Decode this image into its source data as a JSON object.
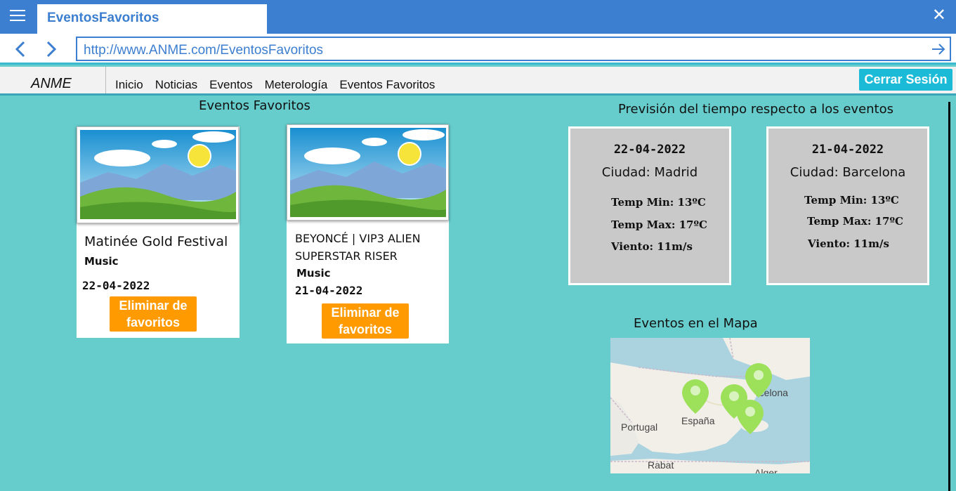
{
  "browser": {
    "tab_title": "EventosFavoritos",
    "url": "http://www.ANME.com/EventosFavoritos"
  },
  "site": {
    "brand": "ANME",
    "menu": [
      "Inicio",
      "Noticias",
      "Eventos",
      "Meterología",
      "Eventos Favoritos"
    ],
    "logout_label": "Cerrar Sesión"
  },
  "favorites": {
    "heading": "Eventos Favoritos",
    "events": [
      {
        "title": "Matinée Gold Festival",
        "tag": "Music",
        "date": "22-04-2022",
        "remove_label": "Eliminar de favoritos"
      },
      {
        "title": "BEYONCÉ | VIP3 ALIEN SUPERSTAR RISER",
        "tag": "Music",
        "date": "21-04-2022",
        "remove_label": "Eliminar de favoritos"
      }
    ]
  },
  "weather": {
    "heading": "Previsión del tiempo respecto a los eventos",
    "forecasts": [
      {
        "date": "22-04-2022",
        "city": "Ciudad: Madrid",
        "temp_min": "Temp Min: 13ºC",
        "temp_max": "Temp Max: 17ºC",
        "wind": "Viento: 11m/s"
      },
      {
        "date": "21-04-2022",
        "city": "Ciudad: Barcelona",
        "temp_min": "Temp Min: 13ºC",
        "temp_max": "Temp Max: 17ºC",
        "wind": "Viento: 11m/s"
      }
    ]
  },
  "map": {
    "heading": "Eventos en el Mapa",
    "labels": {
      "portugal": "Portugal",
      "espana": "España",
      "rabat": "Rabat",
      "barcelona_partial": "rcelona",
      "alger": "Alger"
    },
    "marker_color": "#9de05a"
  },
  "colors": {
    "page_bg": "#66cdcc",
    "chrome_blue": "#3c7ecf",
    "logout_bg": "#1bbbd7",
    "remove_btn": "#ff9b00",
    "weather_box": "#c9c9c9"
  }
}
